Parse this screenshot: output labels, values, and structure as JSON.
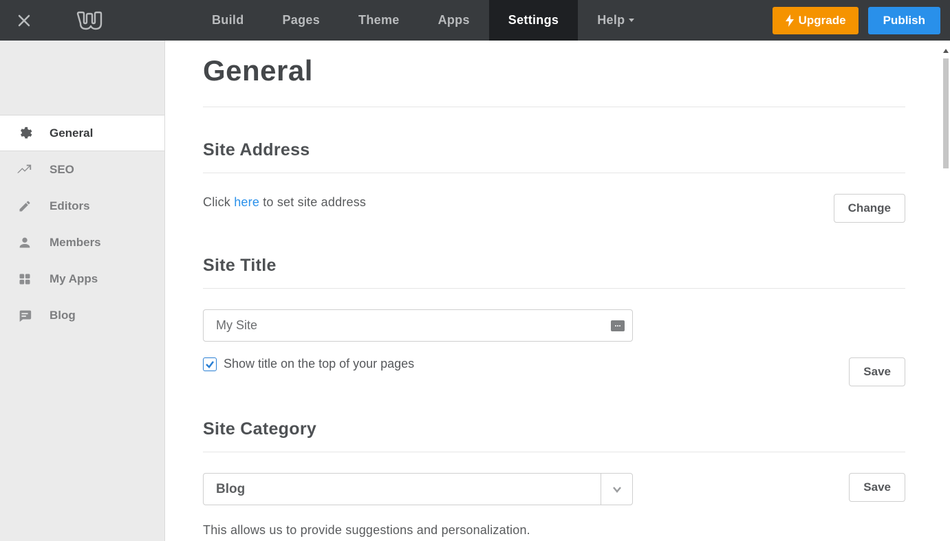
{
  "nav": {
    "items": [
      {
        "label": "Build"
      },
      {
        "label": "Pages"
      },
      {
        "label": "Theme"
      },
      {
        "label": "Apps"
      },
      {
        "label": "Settings"
      },
      {
        "label": "Help"
      }
    ],
    "active_index": 4,
    "upgrade_label": "Upgrade",
    "publish_label": "Publish"
  },
  "sidebar": {
    "items": [
      {
        "label": "General",
        "icon": "gear-icon"
      },
      {
        "label": "SEO",
        "icon": "trend-icon"
      },
      {
        "label": "Editors",
        "icon": "pencil-icon"
      },
      {
        "label": "Members",
        "icon": "person-icon"
      },
      {
        "label": "My Apps",
        "icon": "grid-icon"
      },
      {
        "label": "Blog",
        "icon": "chat-icon"
      }
    ],
    "active_index": 0
  },
  "page": {
    "title": "General",
    "site_address": {
      "heading": "Site Address",
      "hint_prefix": "Click ",
      "hint_link": "here",
      "hint_suffix": " to set site address",
      "change_label": "Change"
    },
    "site_title": {
      "heading": "Site Title",
      "value": "My Site",
      "show_title_label": "Show title on the top of your pages",
      "show_title_checked": true,
      "save_label": "Save"
    },
    "site_category": {
      "heading": "Site Category",
      "selected": "Blog",
      "save_label": "Save",
      "note": "This allows us to provide suggestions and personalization."
    }
  }
}
